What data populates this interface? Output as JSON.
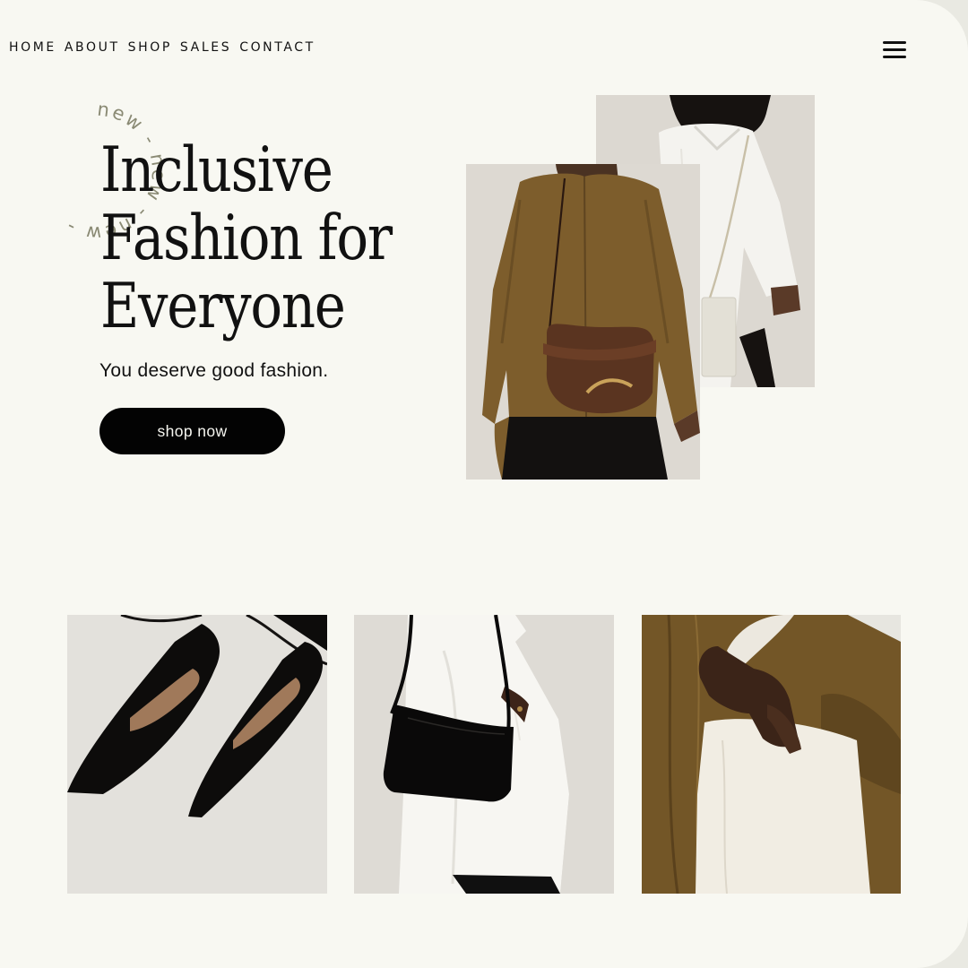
{
  "nav": {
    "items": [
      "HOME",
      "ABOUT",
      "SHOP",
      "SALES",
      "CONTACT"
    ],
    "menu_icon": "hamburger-menu-icon"
  },
  "badge": {
    "text": "new - new - new - "
  },
  "hero": {
    "headline_lines": [
      "Inclusive",
      "Fashion for",
      "Everyone"
    ],
    "tagline": "You deserve good fashion.",
    "cta_label": "shop now"
  },
  "colors": {
    "background": "#f8f8f2",
    "text": "#111111",
    "button": "#030303",
    "button_text": "#f6f6f0",
    "badge_text": "#8a8a74"
  }
}
